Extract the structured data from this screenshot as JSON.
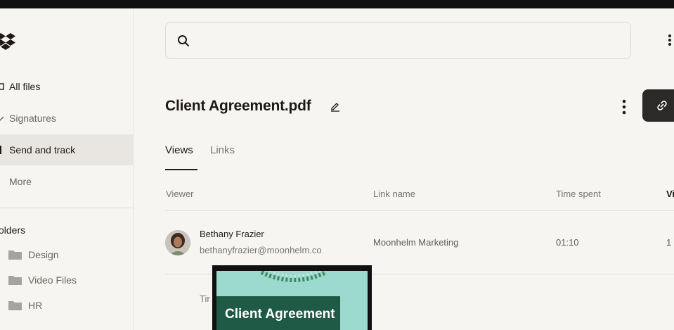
{
  "sidebar": {
    "items": [
      {
        "label": "All files",
        "icon": "folder-icon"
      },
      {
        "label": "Signatures",
        "icon": "pen-icon"
      },
      {
        "label": "Send and track",
        "icon": "send-icon"
      },
      {
        "label": "More",
        "icon": "more-icon"
      }
    ],
    "folders_heading": "olders",
    "folders": [
      {
        "label": "Design"
      },
      {
        "label": "Video Files"
      },
      {
        "label": "HR"
      }
    ]
  },
  "search": {
    "placeholder": ""
  },
  "document": {
    "title": "Client Agreement.pdf"
  },
  "tabs": [
    {
      "label": "Views",
      "active": true
    },
    {
      "label": "Links",
      "active": false
    }
  ],
  "table": {
    "columns": [
      "Viewer",
      "Link name",
      "Time spent",
      "Vi"
    ],
    "rows": [
      {
        "viewer_name": "Bethany Frazier",
        "viewer_email": "bethanyfrazier@moonhelm.co",
        "link_name": "Moonhelm Marketing",
        "time_spent": "01:10",
        "views": "1"
      }
    ],
    "partial_row_text": "Tir"
  },
  "thumbnail": {
    "text": "Client Agreement"
  },
  "colors": {
    "background": "#f7f5f2",
    "topbar": "#111010",
    "active_nav": "#e9e6e2",
    "share_button": "#2b2a28",
    "thumbnail_bg": "#9cdad0",
    "thumbnail_card": "#1f5a46"
  }
}
